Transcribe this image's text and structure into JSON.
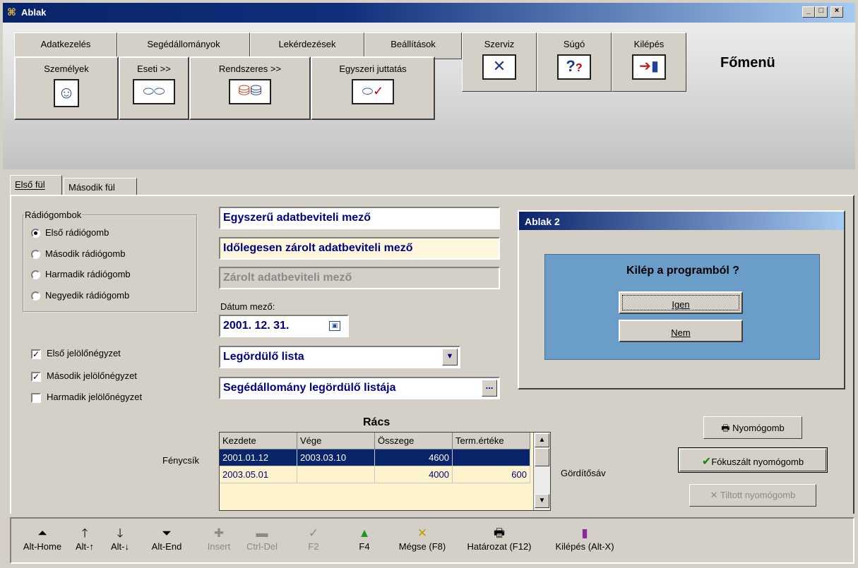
{
  "window": {
    "title": "Ablak",
    "min": "_",
    "max": "□",
    "close": "×"
  },
  "menu": {
    "row1": [
      "Adatkezelés",
      "Segédállományok",
      "Lekérdezések",
      "Beállítások"
    ],
    "tools": [
      {
        "label": "Szerviz",
        "icon": "tools-icon"
      },
      {
        "label": "Súgó",
        "icon": "help-icon"
      },
      {
        "label": "Kilépés",
        "icon": "exit-door-icon"
      }
    ],
    "row2": [
      {
        "label": "Személyek",
        "icon": "person-icon"
      },
      {
        "label": "Eseti >>",
        "icon": "coins-icon"
      },
      {
        "label": "Rendszeres >>",
        "icon": "coin-stack-icon"
      },
      {
        "label": "Egyszeri juttatás",
        "icon": "coins-check-icon"
      }
    ],
    "title": "Főmenü"
  },
  "tabs": [
    "Első fül",
    "Második fül"
  ],
  "radio_group": {
    "legend": "Rádiógombok",
    "options": [
      "Első rádiógomb",
      "Második rádiógomb",
      "Harmadik rádiógomb",
      "Negyedik rádiógomb"
    ],
    "selected": "Első rádiógomb"
  },
  "checkboxes": [
    {
      "label": "Első jelölőnégyzet",
      "checked": true
    },
    {
      "label": "Második jelölőnégyzet",
      "checked": true
    },
    {
      "label": "Harmadik jelölőnégyzet",
      "checked": false
    }
  ],
  "fields": {
    "simple": "Egyszerű adatbeviteli mező",
    "temp_locked": "Időlegesen zárolt adatbeviteli mező",
    "locked": "Zárolt adatbeviteli mező",
    "date_label": "Dátum mező:",
    "date_value": "2001. 12. 31.",
    "dropdown": "Legördülő lista",
    "aux_dropdown": "Segédállomány legördülő listája",
    "aux_btn": "..."
  },
  "dialog": {
    "title": "Ablak 2",
    "question": "Kilép a programból ?",
    "yes": "Igen",
    "no": "Nem"
  },
  "grid": {
    "title": "Rács",
    "row_label": "Fénycsík",
    "scroll_label": "Gördítősáv",
    "columns": [
      "Kezdete",
      "Vége",
      "Összege",
      "Term.értéke"
    ],
    "rows": [
      [
        "2001.01.12",
        "2003.03.10",
        "4600",
        ""
      ],
      [
        "2003.05.01",
        "",
        "4000",
        "600"
      ]
    ]
  },
  "buttons": {
    "push": "Nyomógomb",
    "focused": "Fókuszált nyomógomb",
    "disabled": "Tiltott nyomógomb"
  },
  "toolbar": [
    {
      "label": "Alt-Home",
      "icon": "first-record-icon",
      "enabled": true
    },
    {
      "label": "Alt-↑",
      "icon": "up-arrow-icon",
      "enabled": true
    },
    {
      "label": "Alt-↓",
      "icon": "down-arrow-icon",
      "enabled": true
    },
    {
      "label": "Alt-End",
      "icon": "last-record-icon",
      "enabled": true
    },
    {
      "label": "Insert",
      "icon": "plus-icon",
      "enabled": false
    },
    {
      "label": "Ctrl-Del",
      "icon": "minus-icon",
      "enabled": false
    },
    {
      "label": "F2",
      "icon": "check-icon",
      "enabled": false
    },
    {
      "label": "F4",
      "icon": "triangle-up-icon",
      "enabled": true
    },
    {
      "label": "Mégse (F8)",
      "icon": "cancel-x-icon",
      "enabled": true
    },
    {
      "label": "Határozat (F12)",
      "icon": "printer-icon",
      "enabled": true
    },
    {
      "label": "Kilépés (Alt-X)",
      "icon": "exit-door-icon",
      "enabled": true
    }
  ],
  "colors": {
    "titlebar": "#0a246a",
    "field_text": "#000080",
    "highlight_row": "#0a246a",
    "grid_bg": "#fdf3cc",
    "dialog_body": "#6a9ec9"
  }
}
